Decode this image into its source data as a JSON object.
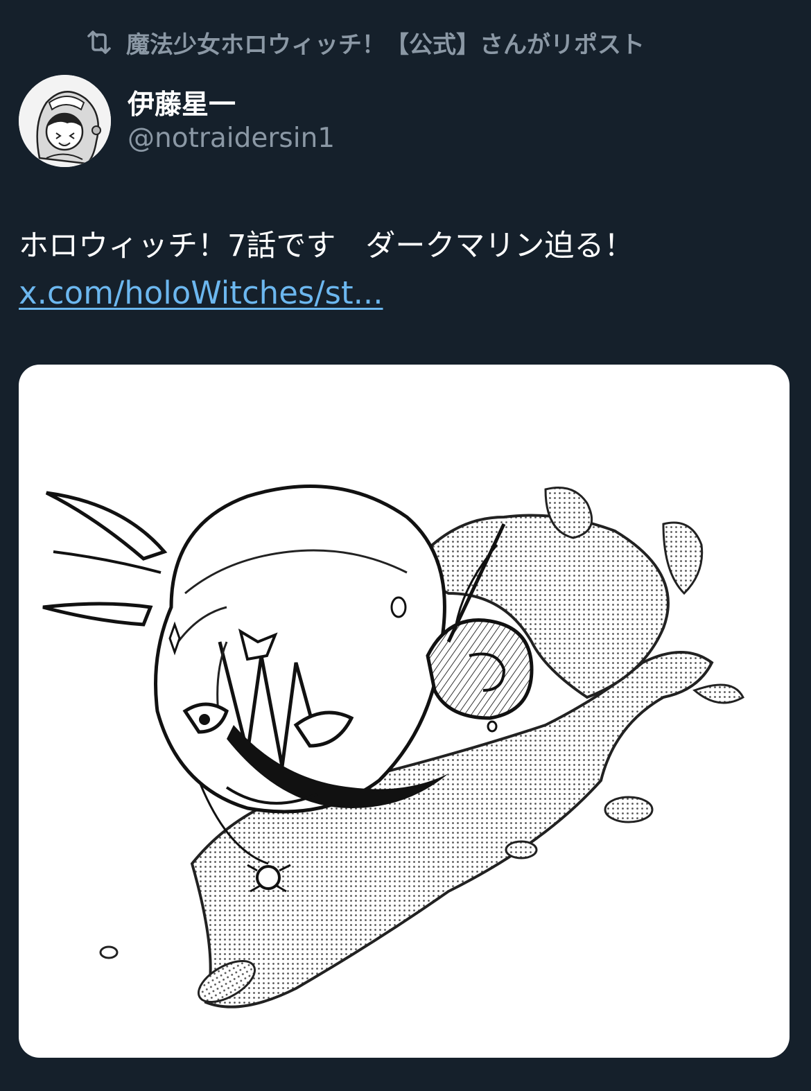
{
  "repost": {
    "icon": "repost-icon",
    "text": "魔法少女ホロウィッチ！【公式】さんがリポスト"
  },
  "author": {
    "avatar_icon": "avatar",
    "display_name": "伊藤星一",
    "handle": "@notraidersin1"
  },
  "tweet": {
    "text": "ホロウィッチ！7話です　ダークマリン迫る！",
    "link_text": "x.com/holoWitches/st..."
  },
  "media": {
    "type": "image",
    "subject": "manga-style ink illustration of a character emerging from splashing water"
  },
  "colors": {
    "background": "#15202b",
    "primary_text": "#ffffff",
    "secondary_text": "#8b98a5",
    "link": "#6cb7ef"
  }
}
